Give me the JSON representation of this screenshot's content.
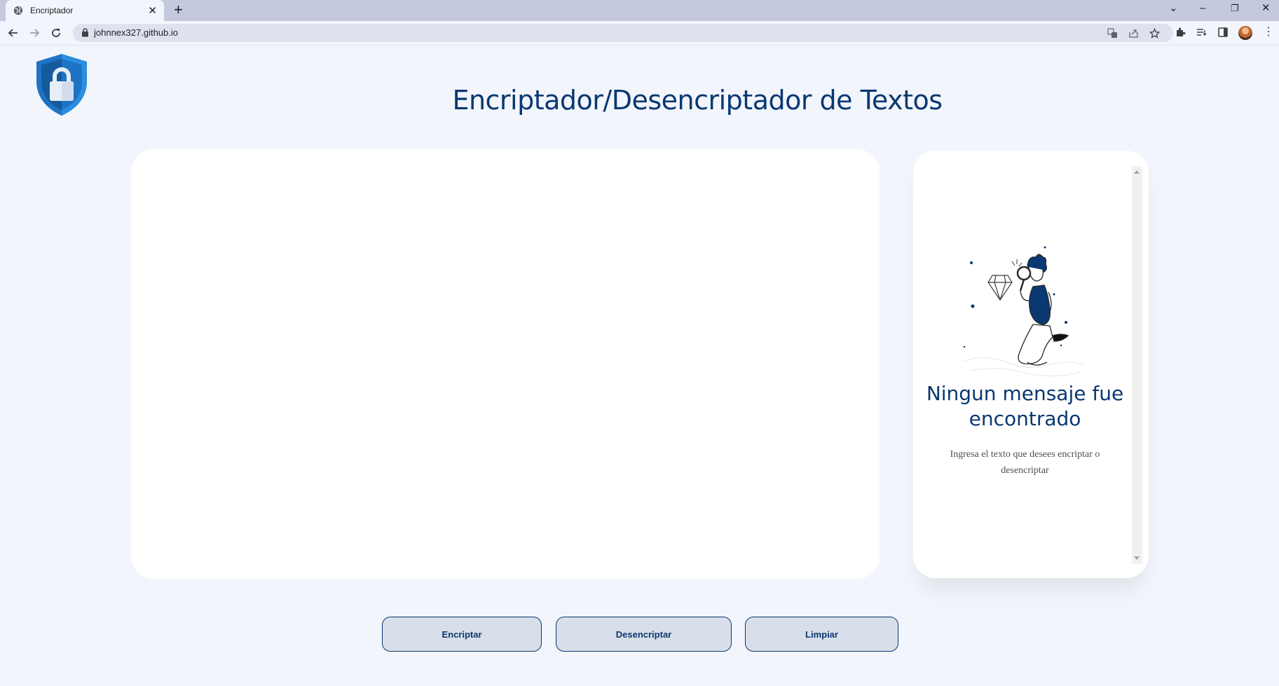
{
  "browser": {
    "tab_title": "Encriptador",
    "tab_close": "✕",
    "new_tab": "+",
    "url": "johnnex327.github.io",
    "window_controls": [
      "⌄",
      "–",
      "❐",
      "✕"
    ],
    "menu": "⋮"
  },
  "page": {
    "title": "Encriptador/Desencriptador de Textos",
    "input": {
      "placeholder": "",
      "value": ""
    },
    "output": {
      "empty_title": "Ningun mensaje fue encontrado",
      "empty_description": "Ingresa el texto que desees encriptar o desencriptar"
    },
    "buttons": {
      "encrypt": "Encriptar",
      "decrypt": "Desencriptar",
      "clear": "Limpiar"
    }
  },
  "colors": {
    "brand": "#0a3871",
    "background": "#f2f5fc",
    "button_fill": "#d8dfea"
  },
  "icons": [
    "globe-icon",
    "back-arrow-icon",
    "forward-arrow-icon",
    "reload-icon",
    "lock-icon",
    "translate-icon",
    "share-icon",
    "star-icon",
    "extensions-icon",
    "reading-list-icon",
    "side-panel-icon",
    "shield-lock-logo"
  ]
}
